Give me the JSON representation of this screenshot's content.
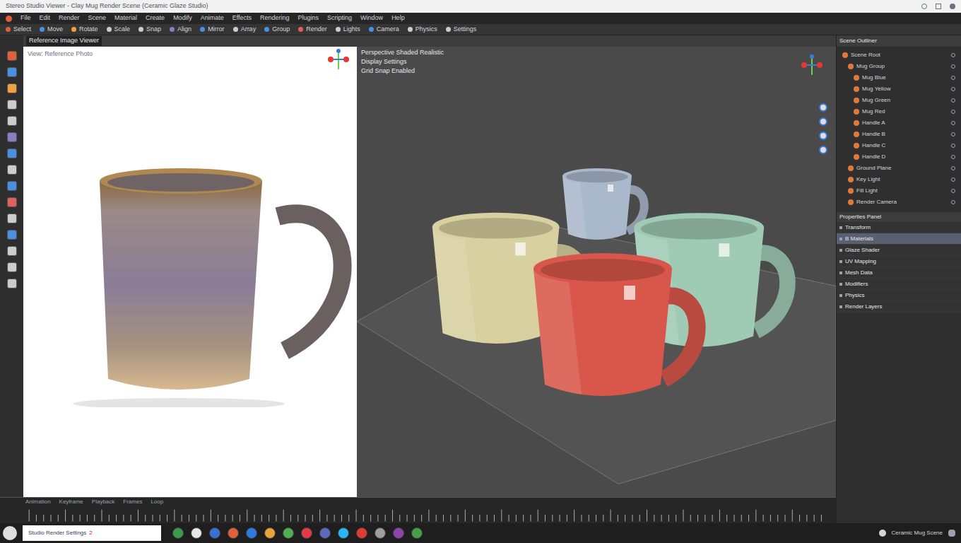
{
  "window": {
    "title": "Stereo Studio Viewer - Clay Mug Render Scene (Ceramic Glaze Studio)"
  },
  "menu": [
    "File",
    "Edit",
    "Render",
    "Scene",
    "Material",
    "Create",
    "Modify",
    "Animate",
    "Effects",
    "Rendering",
    "Plugins",
    "Scripting",
    "Window",
    "Help"
  ],
  "toolbar": [
    "Select",
    "Move",
    "Rotate",
    "Scale",
    "Snap",
    "Align",
    "Mirror",
    "Array",
    "Group",
    "Render",
    "Lights",
    "Camera",
    "Physics",
    "Settings"
  ],
  "left_viewport": {
    "header": "Reference Image Viewer",
    "label": "View: Reference Photo"
  },
  "right_viewport": {
    "header": [
      "Perspective Shaded Realistic",
      "Display Settings",
      "Grid Snap Enabled"
    ]
  },
  "scene_objects": [
    {
      "name": "Mug Blue",
      "color": "#aab8cc"
    },
    {
      "name": "Mug Yellow",
      "color": "#d8d0a0"
    },
    {
      "name": "Mug Green",
      "color": "#9fcbb4"
    },
    {
      "name": "Mug Red",
      "color": "#d9574a"
    }
  ],
  "outliner": {
    "title": "Scene Outliner",
    "items": [
      {
        "label": "Scene Root",
        "depth": 0
      },
      {
        "label": "Mug Group",
        "depth": 1
      },
      {
        "label": "Mug Blue",
        "depth": 2
      },
      {
        "label": "Mug Yellow",
        "depth": 2
      },
      {
        "label": "Mug Green",
        "depth": 2
      },
      {
        "label": "Mug Red",
        "depth": 2
      },
      {
        "label": "Handle A",
        "depth": 2
      },
      {
        "label": "Handle B",
        "depth": 2
      },
      {
        "label": "Handle C",
        "depth": 2
      },
      {
        "label": "Handle D",
        "depth": 2
      },
      {
        "label": "Ground Plane",
        "depth": 1
      },
      {
        "label": "Key Light",
        "depth": 1
      },
      {
        "label": "Fill Light",
        "depth": 1
      },
      {
        "label": "Render Camera",
        "depth": 1
      }
    ]
  },
  "properties": {
    "title": "Properties Panel",
    "items": [
      {
        "label": "Transform",
        "selected": false
      },
      {
        "label": "B Materials",
        "selected": true
      },
      {
        "label": "Glaze Shader",
        "selected": false
      },
      {
        "label": "UV Mapping",
        "selected": false
      },
      {
        "label": "Mesh Data",
        "selected": false
      },
      {
        "label": "Modifiers",
        "selected": false
      },
      {
        "label": "Physics",
        "selected": false
      },
      {
        "label": "Render Layers",
        "selected": false
      }
    ]
  },
  "timeline": {
    "labels": [
      "Animation",
      "Keyframe",
      "Playback",
      "Frames",
      "Loop"
    ]
  },
  "taskbar": {
    "label": "Studio Render Settings",
    "badge": "2",
    "status": "Ceramic Mug Scene",
    "apps": [
      {
        "color": "#3a9b4a"
      },
      {
        "color": "#e8e8e8"
      },
      {
        "color": "#3a6fd8"
      },
      {
        "color": "#e0603a"
      },
      {
        "color": "#2d7be0"
      },
      {
        "color": "#e8a23a"
      },
      {
        "color": "#4caf50"
      },
      {
        "color": "#e53945"
      },
      {
        "color": "#5c6bc0"
      },
      {
        "color": "#29b6f6"
      },
      {
        "color": "#e53935"
      },
      {
        "color": "#9e9e9e"
      },
      {
        "color": "#8e44ad"
      },
      {
        "color": "#43a047"
      }
    ]
  }
}
